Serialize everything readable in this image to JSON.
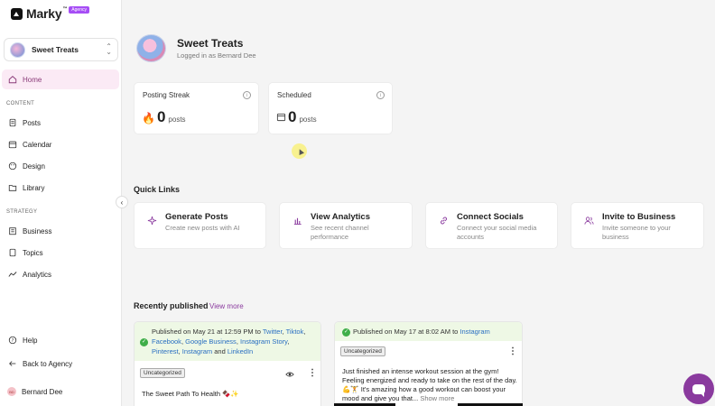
{
  "app": {
    "name": "Marky",
    "tm": "™",
    "badge": "Agency"
  },
  "business_selector": {
    "name": "Sweet Treats"
  },
  "sidebar": {
    "home": "Home",
    "content_section": "CONTENT",
    "content_items": [
      "Posts",
      "Calendar",
      "Design",
      "Library"
    ],
    "strategy_section": "STRATEGY",
    "strategy_items": [
      "Business",
      "Topics",
      "Analytics"
    ],
    "help": "Help",
    "back": "Back to Agency",
    "user": "Bernard Dee",
    "user_initials": "BD"
  },
  "header": {
    "title": "Sweet Treats",
    "subtitle": "Logged in as Bernard Dee"
  },
  "stats": [
    {
      "title": "Posting Streak",
      "value": "0",
      "unit": "posts"
    },
    {
      "title": "Scheduled",
      "value": "0",
      "unit": "posts"
    }
  ],
  "quick_links": {
    "title": "Quick Links",
    "items": [
      {
        "title": "Generate Posts",
        "desc": "Create new posts with AI"
      },
      {
        "title": "View Analytics",
        "desc": "See recent channel performance"
      },
      {
        "title": "Connect Socials",
        "desc": "Connect your social media accounts"
      },
      {
        "title": "Invite to Business",
        "desc": "Invite someone to your business"
      }
    ]
  },
  "recent": {
    "title": "Recently published",
    "view_more": "View more",
    "posts": [
      {
        "prefix": "Published on May 21 at 12:59 PM to",
        "platforms": [
          "Twitter",
          "Tiktok",
          "Facebook",
          "Google Business",
          "Instagram Story",
          "Pinterest",
          "Instagram",
          "LinkedIn"
        ],
        "and": "and",
        "tag": "Uncategorized",
        "text": "The Sweet Path To Health 🍫✨"
      },
      {
        "prefix": "Published on May 17 at 8:02 AM to",
        "platforms": [
          "Instagram"
        ],
        "tag": "Uncategorized",
        "text": "Just finished an intense workout session at the gym! Feeling energized and ready to take on the rest of the day. 💪🏋️ It's amazing how a good workout can boost your mood and give you that...",
        "show_more": "Show more"
      }
    ]
  },
  "colors": {
    "accent": "#8a3a9e",
    "active_bg": "#fbeaf5",
    "published_bg": "#eef8e5",
    "link": "#2a6fc2"
  }
}
